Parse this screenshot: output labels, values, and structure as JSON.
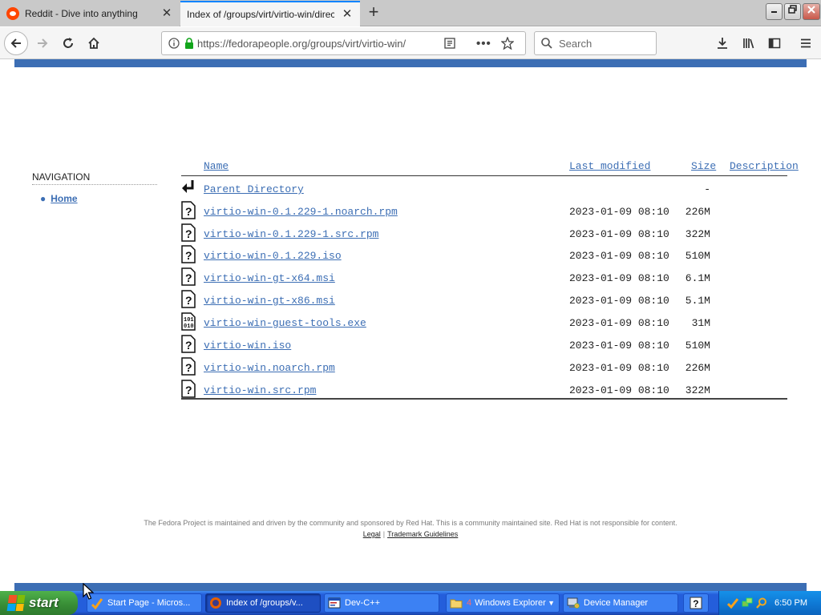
{
  "browser": {
    "tabs": [
      {
        "title": "Reddit - Dive into anything",
        "active": false,
        "icon": "reddit-icon"
      },
      {
        "title": "Index of /groups/virt/virtio-win/direct-",
        "active": true,
        "icon": "none"
      }
    ],
    "new_tab_icon": "plus-icon",
    "window_controls": [
      "minimize-icon",
      "restore-icon",
      "close-icon"
    ],
    "url": "https://fedorapeople.org/groups/virt/virtio-win/",
    "search_placeholder": "Search",
    "accent_color": "#0a84ff"
  },
  "page": {
    "brand_color": "#3c6eb4",
    "navigation": {
      "heading": "NAVIGATION",
      "items": [
        {
          "label": "Home"
        }
      ]
    },
    "listing": {
      "columns": {
        "name": "Name",
        "modified": "Last modified",
        "size": "Size",
        "description": "Description"
      },
      "parent": {
        "name": "Parent Directory",
        "size": "-",
        "icon": "back-arrow-icon"
      },
      "files": [
        {
          "name": "virtio-win-0.1.229-1.noarch.rpm",
          "modified": "2023-01-09 08:10",
          "size": "226M",
          "icon": "unknown-file-icon"
        },
        {
          "name": "virtio-win-0.1.229-1.src.rpm",
          "modified": "2023-01-09 08:10",
          "size": "322M",
          "icon": "unknown-file-icon"
        },
        {
          "name": "virtio-win-0.1.229.iso",
          "modified": "2023-01-09 08:10",
          "size": "510M",
          "icon": "unknown-file-icon"
        },
        {
          "name": "virtio-win-gt-x64.msi",
          "modified": "2023-01-09 08:10",
          "size": "6.1M",
          "icon": "unknown-file-icon"
        },
        {
          "name": "virtio-win-gt-x86.msi",
          "modified": "2023-01-09 08:10",
          "size": "5.1M",
          "icon": "unknown-file-icon"
        },
        {
          "name": "virtio-win-guest-tools.exe",
          "modified": "2023-01-09 08:10",
          "size": "31M",
          "icon": "binary-file-icon"
        },
        {
          "name": "virtio-win.iso",
          "modified": "2023-01-09 08:10",
          "size": "510M",
          "icon": "unknown-file-icon"
        },
        {
          "name": "virtio-win.noarch.rpm",
          "modified": "2023-01-09 08:10",
          "size": "226M",
          "icon": "unknown-file-icon"
        },
        {
          "name": "virtio-win.src.rpm",
          "modified": "2023-01-09 08:10",
          "size": "322M",
          "icon": "unknown-file-icon"
        }
      ]
    },
    "footer": {
      "text": "The Fedora Project is maintained and driven by the community and sponsored by Red Hat. This is a community maintained site. Red Hat is not responsible for content.",
      "links": [
        "Legal",
        "Trademark Guidelines"
      ]
    }
  },
  "taskbar": {
    "start_label": "start",
    "items": [
      {
        "label": "Start Page - Micros...",
        "icon": "dev-cpp-icon",
        "active": false
      },
      {
        "label": "Index of /groups/v...",
        "icon": "firefox-icon",
        "active": true
      },
      {
        "label": "Dev-C++",
        "icon": "dev-cpp-icon",
        "active": false
      },
      {
        "label": "Windows Explorer",
        "icon": "folder-icon",
        "active": false,
        "count": "4"
      },
      {
        "label": "Device Manager",
        "icon": "device-manager-icon",
        "active": false
      }
    ],
    "help_icon": "help-icon",
    "tray_icons": [
      "dev-cpp-tray-icon",
      "network-icon",
      "search-tray-icon"
    ],
    "clock": "6:50 PM"
  }
}
